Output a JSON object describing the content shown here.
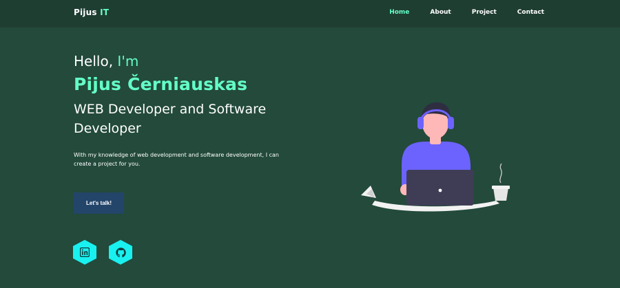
{
  "nav": {
    "logo_main": "Pijus",
    "logo_accent": "IT",
    "items": [
      {
        "label": "Home",
        "active": true
      },
      {
        "label": "About",
        "active": false
      },
      {
        "label": "Project",
        "active": false
      },
      {
        "label": "Contact",
        "active": false
      }
    ]
  },
  "hero": {
    "greeting": "Hello,",
    "greeting_accent": "I'm",
    "name": "Pijus Černiauskas",
    "role": "WEB Developer and Software Developer",
    "description": "With my knowledge of web development and software development, I can create a project for you.",
    "cta_label": "Let's talk!"
  },
  "social": [
    {
      "name": "linkedin",
      "icon": "linkedin-icon"
    },
    {
      "name": "github",
      "icon": "github-icon"
    }
  ],
  "colors": {
    "background": "#234a3b",
    "navbar": "#1f3e32",
    "accent": "#64ffc8",
    "button": "#23456a",
    "social": "#19f0f0",
    "shirt": "#6c63ff"
  }
}
